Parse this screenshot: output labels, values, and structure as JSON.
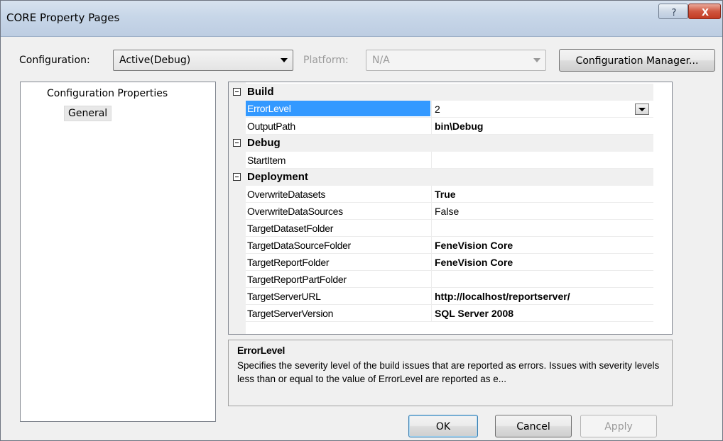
{
  "window": {
    "title": "CORE Property Pages",
    "help_glyph": "?",
    "close_glyph": "X"
  },
  "config": {
    "configuration_label": "Configuration:",
    "configuration_value": "Active(Debug)",
    "platform_label": "Platform:",
    "platform_value": "N/A",
    "manager_button": "Configuration Manager..."
  },
  "tree": {
    "root": "Configuration Properties",
    "child": "General"
  },
  "properties": {
    "categories": [
      {
        "name": "Build",
        "items": [
          {
            "name": "ErrorLevel",
            "value": "2",
            "bold": false,
            "selected": true
          },
          {
            "name": "OutputPath",
            "value": "bin\\Debug",
            "bold": true
          }
        ]
      },
      {
        "name": "Debug",
        "items": [
          {
            "name": "StartItem",
            "value": "",
            "bold": false
          }
        ]
      },
      {
        "name": "Deployment",
        "items": [
          {
            "name": "OverwriteDatasets",
            "value": "True",
            "bold": true
          },
          {
            "name": "OverwriteDataSources",
            "value": "False",
            "bold": false
          },
          {
            "name": "TargetDatasetFolder",
            "value": "",
            "bold": false
          },
          {
            "name": "TargetDataSourceFolder",
            "value": "FeneVision Core",
            "bold": true
          },
          {
            "name": "TargetReportFolder",
            "value": "FeneVision Core",
            "bold": true
          },
          {
            "name": "TargetReportPartFolder",
            "value": "",
            "bold": false
          },
          {
            "name": "TargetServerURL",
            "value": "http://localhost/reportserver/",
            "bold": true
          },
          {
            "name": "TargetServerVersion",
            "value": "SQL Server 2008",
            "bold": true
          }
        ]
      }
    ]
  },
  "description": {
    "title": "ErrorLevel",
    "text": "Specifies the severity level of the build issues that are reported as errors. Issues with severity levels less than or equal to the value of ErrorLevel are reported as e..."
  },
  "buttons": {
    "ok": "OK",
    "cancel": "Cancel",
    "apply": "Apply"
  }
}
